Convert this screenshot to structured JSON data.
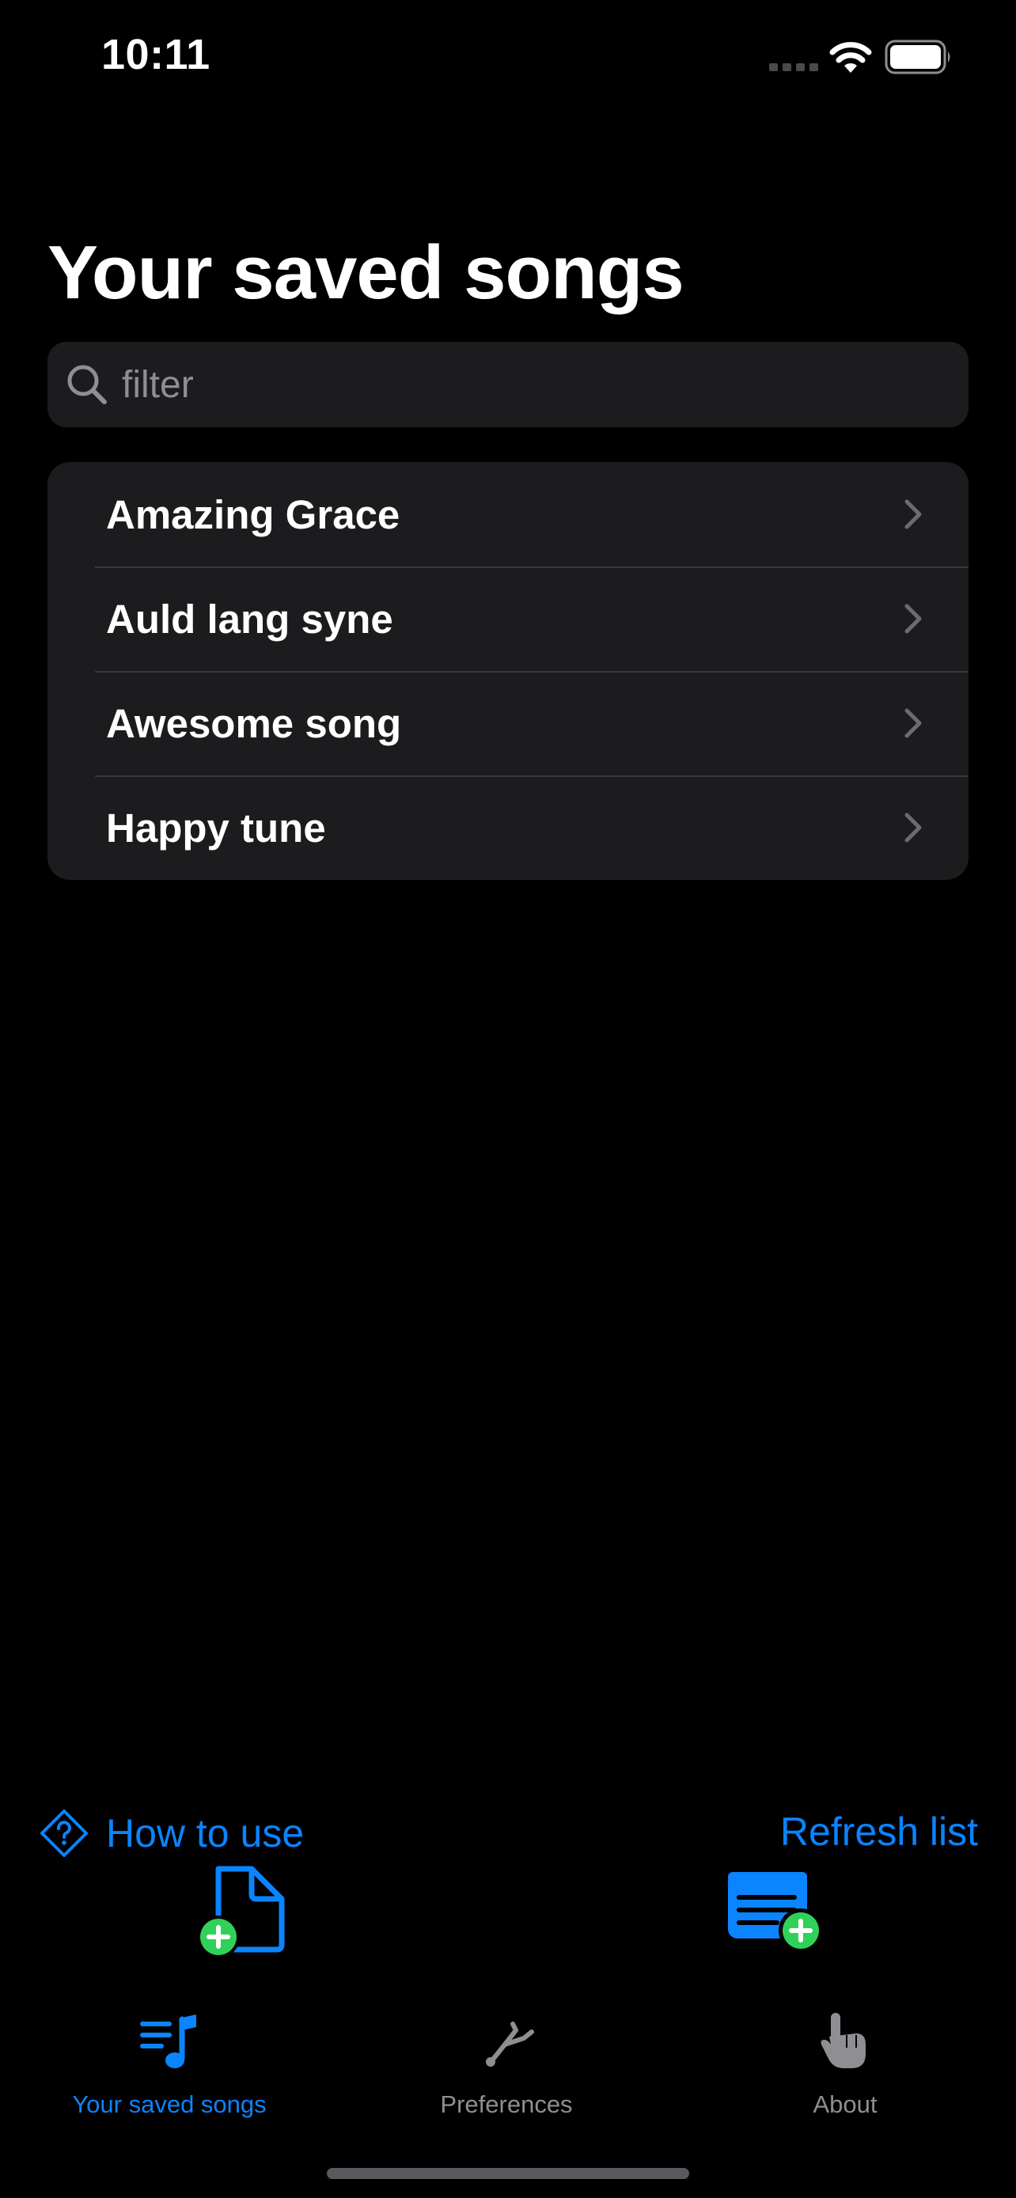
{
  "status_bar": {
    "time": "10:11"
  },
  "page": {
    "title": "Your saved songs"
  },
  "search": {
    "placeholder": "filter",
    "value": ""
  },
  "songs": [
    {
      "title": "Amazing Grace"
    },
    {
      "title": "Auld lang syne"
    },
    {
      "title": "Awesome song"
    },
    {
      "title": "Happy tune"
    }
  ],
  "actions": {
    "how_to_use": "How to use",
    "refresh_list": "Refresh list",
    "add_file_icon": "doc-plus-icon",
    "add_list_icon": "list-plus-icon"
  },
  "tabs": [
    {
      "label": "Your saved songs",
      "icon": "music-list-icon",
      "selected": true
    },
    {
      "label": "Preferences",
      "icon": "tuning-fork-icon",
      "selected": false
    },
    {
      "label": "About",
      "icon": "hand-point-icon",
      "selected": false
    }
  ],
  "colors": {
    "background": "#000000",
    "surface": "#1c1c1e",
    "accent": "#0a84ff",
    "add_badge": "#30d158",
    "inactive": "#8e8e93"
  }
}
